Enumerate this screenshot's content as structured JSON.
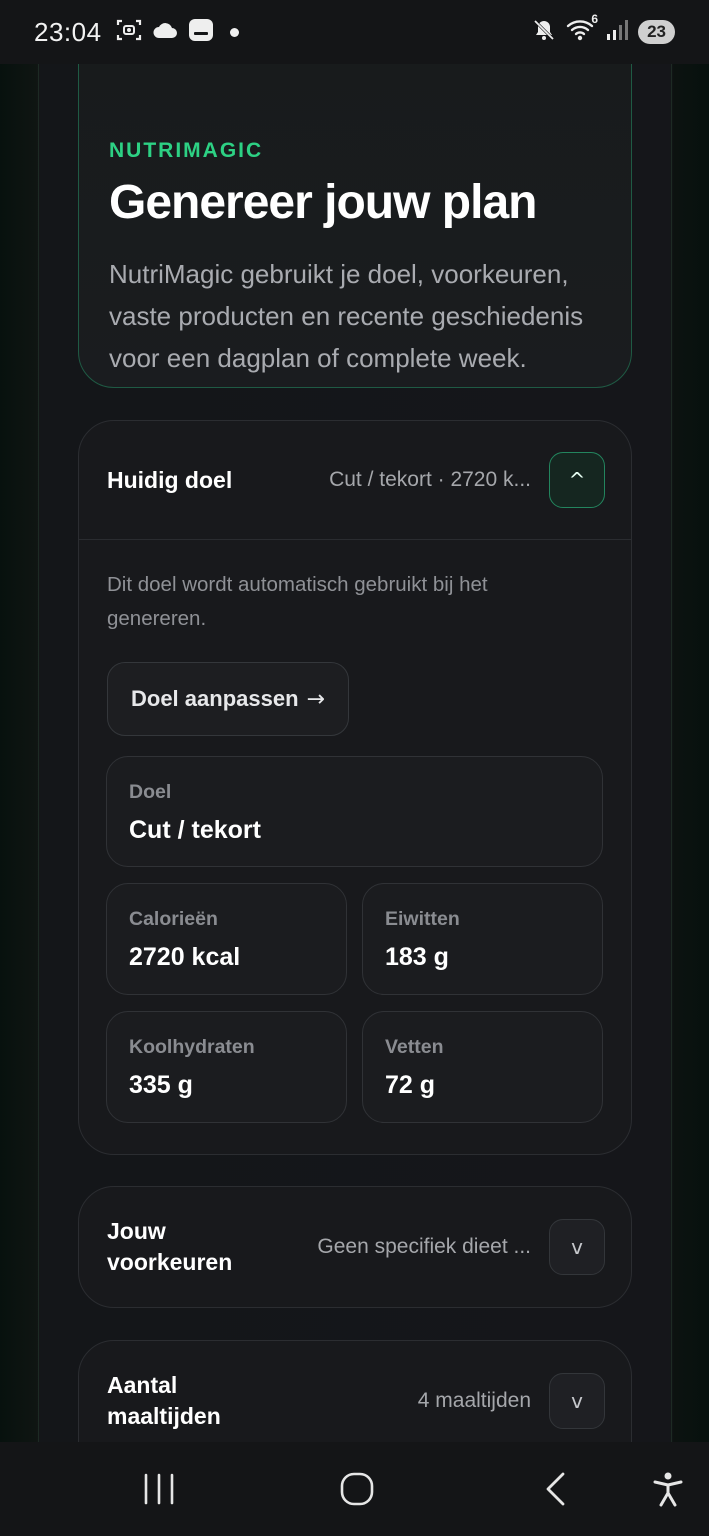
{
  "status_bar": {
    "time": "23:04",
    "left_icons": [
      "screenshot-icon",
      "cloud-icon",
      "message-icon",
      "notification-dot-icon"
    ],
    "right_icons": [
      "mute-icon",
      "wifi-icon",
      "signal-icon"
    ],
    "wifi_label": "6",
    "battery": "23"
  },
  "hero": {
    "eyebrow": "NUTRIMAGIC",
    "title": "Genereer jouw plan",
    "description": "NutriMagic gebruikt je doel, voorkeuren, vaste producten en recente geschiedenis voor een dagplan of complete week."
  },
  "goal_card": {
    "title": "Huidig doel",
    "summary": "Cut / tekort · 2720 k...",
    "toggle": "^",
    "expanded": true,
    "help_text": "Dit doel wordt automatisch gebruikt bij het genereren.",
    "adjust_button": "Doel aanpassen",
    "adjust_arrow": "→",
    "goal_label": "Doel",
    "goal_value": "Cut / tekort",
    "calories_label": "Calorieën",
    "calories_value": "2720 kcal",
    "protein_label": "Eiwitten",
    "protein_value": "183 g",
    "carbs_label": "Koolhydraten",
    "carbs_value": "335 g",
    "fat_label": "Vetten",
    "fat_value": "72 g"
  },
  "preferences_card": {
    "title": "Jouw voorkeuren",
    "summary": "Geen specifiek dieet ...",
    "toggle": "v",
    "expanded": false
  },
  "meals_card": {
    "title": "Aantal maaltijden",
    "summary": "4 maaltijden",
    "toggle": "v",
    "expanded": false
  },
  "nav_bar": {
    "items": [
      "recent-apps-icon",
      "home-icon",
      "back-icon",
      "accessibility-icon"
    ]
  },
  "colors": {
    "accent": "#2dd184",
    "background": "#15161a",
    "card": "#18191c",
    "border_accent": "#1f5a44"
  }
}
